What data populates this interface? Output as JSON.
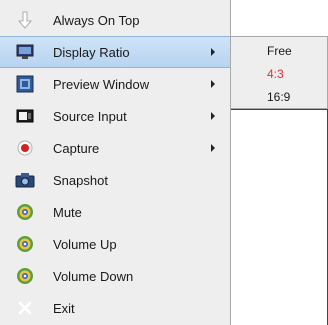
{
  "menu": {
    "items": [
      {
        "label": "Always On Top",
        "icon": "arrow-down-icon",
        "has_submenu": false
      },
      {
        "label": "Display Ratio",
        "icon": "monitor-icon",
        "has_submenu": true,
        "active": true
      },
      {
        "label": "Preview Window",
        "icon": "preview-window-icon",
        "has_submenu": true
      },
      {
        "label": "Source Input",
        "icon": "source-input-icon",
        "has_submenu": true
      },
      {
        "label": "Capture",
        "icon": "record-icon",
        "has_submenu": true
      },
      {
        "label": "Snapshot",
        "icon": "camera-icon",
        "has_submenu": false
      },
      {
        "label": "Mute",
        "icon": "speaker-icon",
        "has_submenu": false
      },
      {
        "label": "Volume Up",
        "icon": "speaker-icon",
        "has_submenu": false
      },
      {
        "label": "Volume Down",
        "icon": "speaker-icon",
        "has_submenu": false
      },
      {
        "label": "Exit",
        "icon": "close-icon",
        "has_submenu": false
      }
    ]
  },
  "submenu": {
    "items": [
      {
        "label": "Free",
        "selected": false
      },
      {
        "label": "4:3",
        "selected": true
      },
      {
        "label": "16:9",
        "selected": false
      }
    ]
  },
  "colors": {
    "menu_bg": "#eeeeee",
    "highlight": "#c4dcf4",
    "selected_text": "#e23030"
  }
}
